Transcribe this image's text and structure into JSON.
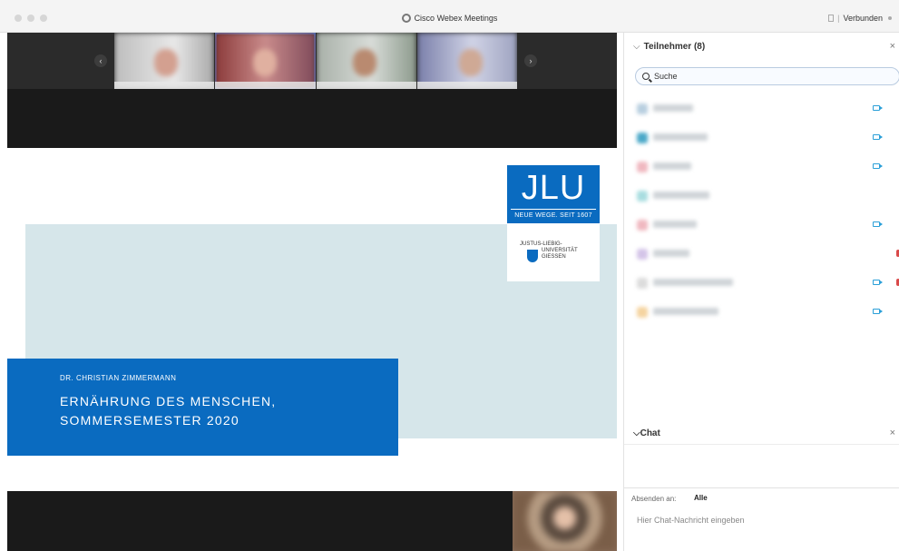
{
  "window": {
    "title": "Cisco Webex Meetings",
    "status": "Verbunden"
  },
  "slide": {
    "logo_letters": "JLU",
    "logo_tagline": "NEUE WEGE. SEIT 1607",
    "university_line1": "JUSTUS-LIEBIG-",
    "university_line2": "UNIVERSITÄT",
    "university_line3": "GIESSEN",
    "author": "DR. CHRISTIAN ZIMMERMANN",
    "course_line1": "ERNÄHRUNG DES MENSCHEN,",
    "course_line2": "SOMMERSEMESTER 2020"
  },
  "participants_panel": {
    "title": "Teilnehmer (8)",
    "search_placeholder": "Suche"
  },
  "chat": {
    "title": "Chat",
    "send_to_label": "Absenden an:",
    "send_to_value": "Alle",
    "input_placeholder": "Hier Chat-Nachricht eingeben"
  },
  "icons": {
    "camera": "video-camera-icon",
    "microphone": "microphone-icon",
    "search": "search-icon",
    "close": "close-icon",
    "chevron": "chevron-down-icon"
  },
  "colors": {
    "jlu_blue": "#0a6bc0",
    "slide_band": "#d6e6ea",
    "camera_icon": "#2a9fd8",
    "muted_mic": "#d94a4a"
  }
}
